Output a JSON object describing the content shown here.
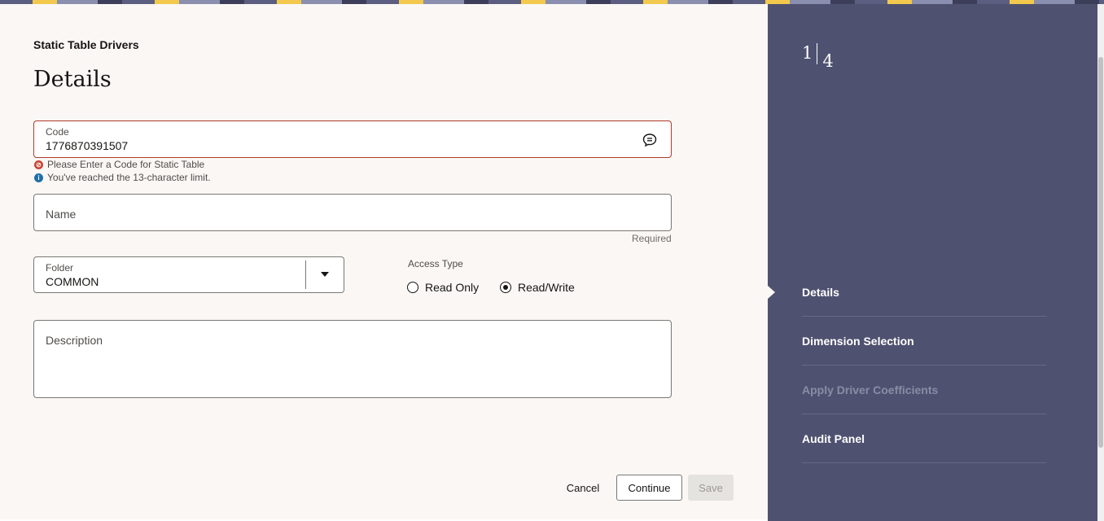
{
  "header": {
    "breadcrumb": "Static Table Drivers",
    "title": "Details"
  },
  "form": {
    "code": {
      "label": "Code",
      "value": "1776870391507",
      "error_message": "Please Enter a Code for Static Table",
      "info_message": "You've reached the 13-character limit."
    },
    "name": {
      "label": "Name",
      "helper": "Required"
    },
    "folder": {
      "label": "Folder",
      "value": "COMMON"
    },
    "access_type": {
      "label": "Access Type",
      "options": [
        {
          "label": "Read Only",
          "checked": false
        },
        {
          "label": "Read/Write",
          "checked": true
        }
      ]
    },
    "description": {
      "label": "Description"
    }
  },
  "buttons": {
    "cancel": "Cancel",
    "continue": "Continue",
    "save": "Save"
  },
  "train": {
    "current": "1",
    "total": "4",
    "steps": [
      {
        "label": "Details",
        "state": "current"
      },
      {
        "label": "Dimension Selection",
        "state": "enabled"
      },
      {
        "label": "Apply Driver Coefficients",
        "state": "disabled"
      },
      {
        "label": "Audit Panel",
        "state": "enabled"
      }
    ]
  },
  "colors": {
    "sidebar_bg": "#4f5170",
    "error": "#c74634",
    "info": "#1f6fa8"
  }
}
